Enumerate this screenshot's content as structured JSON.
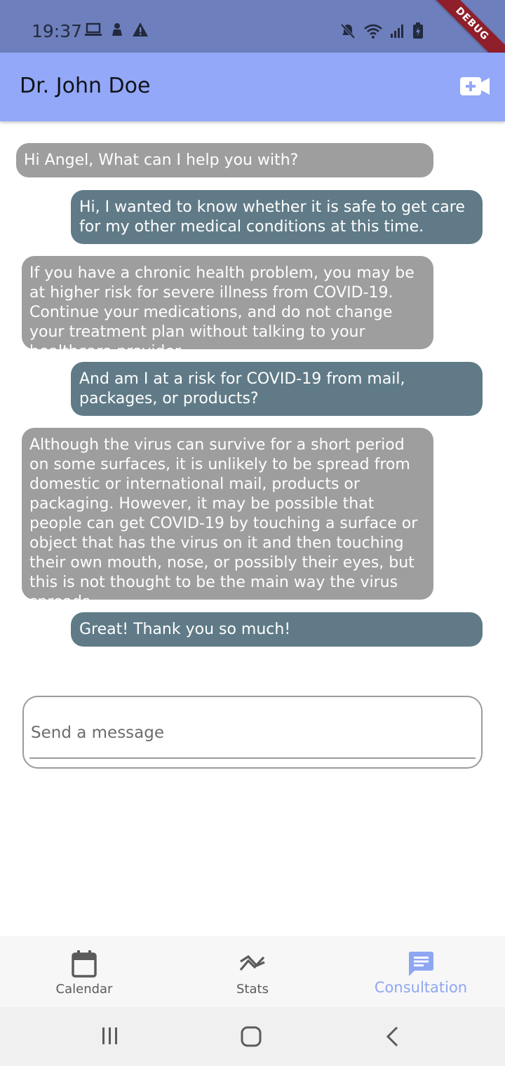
{
  "status_bar": {
    "time": "19:37",
    "left_icons": [
      "laptop-icon",
      "notification-icon",
      "warning-icon"
    ],
    "right_icons": [
      "mute-icon",
      "wifi-icon",
      "signal-icon",
      "battery-icon"
    ]
  },
  "debug_banner": "DEBUG",
  "app_bar": {
    "title": "Dr. John Doe",
    "action_icon": "video-call-icon"
  },
  "messages": [
    {
      "from": "doctor",
      "text": "Hi Angel, What can I help you with?"
    },
    {
      "from": "patient",
      "text": "Hi, I wanted to know whether it is safe to get care for my other medical conditions at this time."
    },
    {
      "from": "doctor",
      "text": "If you have a chronic health problem, you may be at higher risk for severe illness from COVID-19. Continue your medications, and do not change your treatment plan without talking to your healthcare provider."
    },
    {
      "from": "patient",
      "text": "And am I at a risk for COVID-19 from mail, packages, or products?"
    },
    {
      "from": "doctor",
      "text": "Although the virus can survive for a short period on some surfaces, it is unlikely to be spread from domestic or international mail, products or packaging. However, it may be possible that people can get COVID-19 by touching a surface or object that has the virus on it and then touching their own mouth, nose, or possibly their eyes, but this is not thought to be the main way the virus spreads."
    },
    {
      "from": "patient",
      "text": "Great! Thank you so much!"
    }
  ],
  "composer": {
    "placeholder": "Send a message",
    "value": ""
  },
  "bottom_nav": {
    "items": [
      {
        "label": "Calendar",
        "icon": "calendar-icon",
        "active": false
      },
      {
        "label": "Stats",
        "icon": "stats-icon",
        "active": false
      },
      {
        "label": "Consultation",
        "icon": "chat-icon",
        "active": true
      }
    ]
  },
  "system_nav": [
    "recent-apps-icon",
    "home-icon",
    "back-icon"
  ],
  "colors": {
    "status_bar": "#6e7fbd",
    "app_bar": "#93a8f8",
    "received_bubble": "#9e9e9e",
    "sent_bubble": "#607b87",
    "active_nav": "#8ea6f2"
  }
}
